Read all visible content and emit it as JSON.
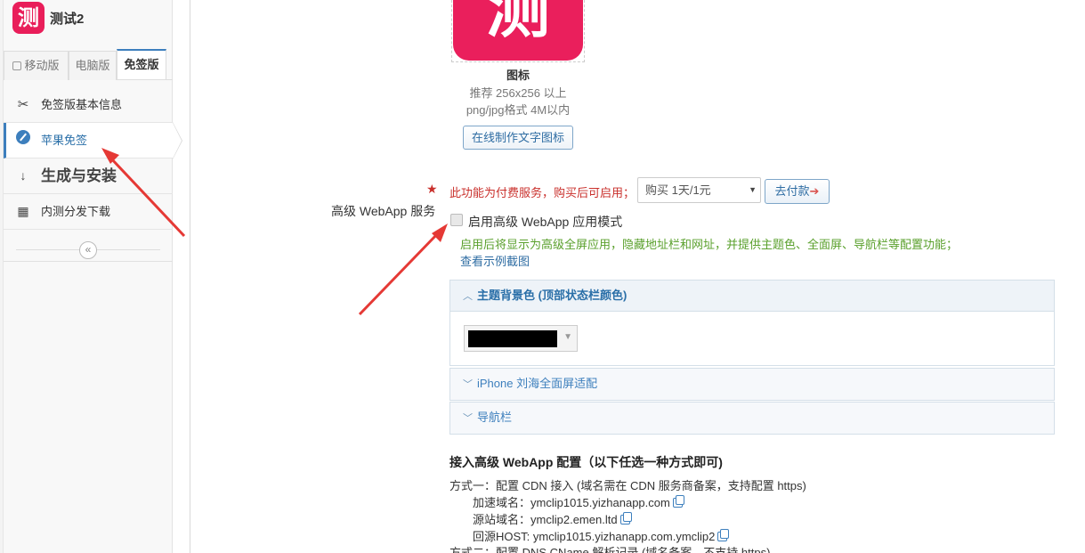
{
  "app": {
    "logo_char": "测",
    "name": "测试2"
  },
  "version_tabs": [
    {
      "label": "移动版"
    },
    {
      "label": "电脑版"
    },
    {
      "label": "免签版"
    }
  ],
  "menu": [
    {
      "label": "免签版基本信息",
      "icon": "scissors-icon"
    },
    {
      "label": "苹果免签",
      "icon": "compass-icon"
    },
    {
      "label": "生成与安装",
      "icon": "binary-sort-icon"
    },
    {
      "label": "内测分发下载",
      "icon": "qrcode-icon"
    }
  ],
  "icon_section": {
    "logo_char": "测",
    "title": "图标",
    "hint1": "推荐 256x256 以上",
    "hint2": "png/jpg格式 4M以内",
    "make_button": "在线制作文字图标"
  },
  "paid": {
    "note": "此功能为付费服务，购买后可启用；",
    "select_value": "购买 1天/1元",
    "pay_button": "去付款"
  },
  "webapp": {
    "label": "高级 WebApp 服务",
    "checkbox_label": "启用高级 WebApp 应用模式",
    "checked": false,
    "note": "启用后将显示为高级全屏应用，隐藏地址栏和网址，并提供主题色、全面屏、导航栏等配置功能；",
    "example_link": "查看示例截图"
  },
  "panels": [
    {
      "title": "主题背景色 (顶部状态栏颜色)",
      "open": true,
      "color": "#000000"
    },
    {
      "title": "iPhone 刘海全面屏适配",
      "open": false
    },
    {
      "title": "导航栏",
      "open": false
    }
  ],
  "config": {
    "title": "接入高级 WebApp 配置（以下任选一种方式即可)",
    "method1": "方式一：配置 CDN 接入 (域名需在 CDN 服务商备案，支持配置 https)",
    "accel_label": "加速域名：",
    "accel_value": "ymclip1015.yizhanapp.com",
    "origin_label": "源站域名：",
    "origin_value": "ymclip2.emen.ltd",
    "host_label": "回源HOST: ",
    "host_value": "ymclip1015.yizhanapp.com.ymclip2",
    "method2": "方式二：配置 DNS CName 解析记录 (域名备案，不支持 https)"
  },
  "colors": {
    "accent": "#3d7fbd",
    "brand": "#e91e5a",
    "warning": "#c9302c",
    "success": "#5aa02c"
  }
}
